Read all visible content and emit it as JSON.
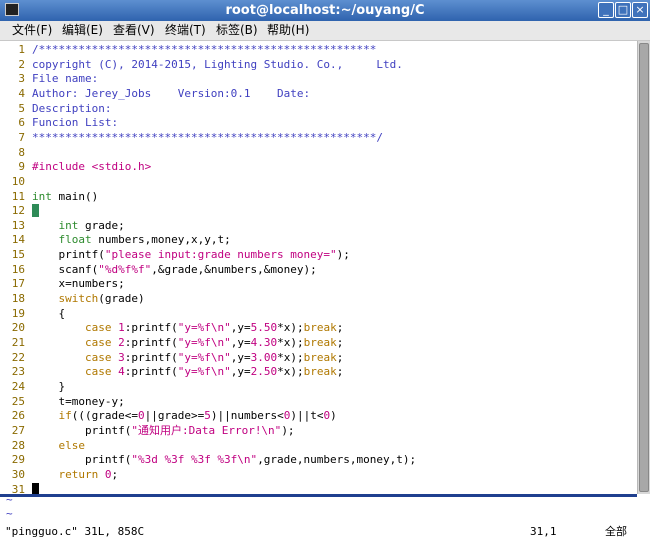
{
  "window": {
    "title": "root@localhost:~/ouyang/C",
    "controls": [
      "_",
      "□",
      "×"
    ]
  },
  "menu": [
    "文件(F)",
    "编辑(E)",
    "查看(V)",
    "终端(T)",
    "标签(B)",
    "帮助(H)"
  ],
  "editor": {
    "lines": [
      {
        "n": "1",
        "segs": [
          {
            "t": "/***************************************************",
            "c": "cm"
          }
        ]
      },
      {
        "n": "2",
        "segs": [
          {
            "t": "copyright (C), 2014-2015, Lighting Studio. Co.,     Ltd.",
            "c": "cm"
          }
        ]
      },
      {
        "n": "3",
        "segs": [
          {
            "t": "File name:",
            "c": "cm"
          }
        ]
      },
      {
        "n": "4",
        "segs": [
          {
            "t": "Author: Jerey_Jobs    Version:0.1    Date:",
            "c": "cm"
          }
        ]
      },
      {
        "n": "5",
        "segs": [
          {
            "t": "Description:",
            "c": "cm"
          }
        ]
      },
      {
        "n": "6",
        "segs": [
          {
            "t": "Funcion List:",
            "c": "cm"
          }
        ]
      },
      {
        "n": "7",
        "segs": [
          {
            "t": "****************************************************/",
            "c": "cm"
          }
        ]
      },
      {
        "n": "8",
        "segs": []
      },
      {
        "n": "9",
        "segs": [
          {
            "t": "#include <stdio.h>",
            "c": "pp"
          }
        ]
      },
      {
        "n": "10",
        "segs": []
      },
      {
        "n": "11",
        "segs": [
          {
            "t": "int",
            "c": "ty"
          },
          {
            "t": " main()",
            "c": ""
          }
        ]
      },
      {
        "n": "12",
        "segs": [
          {
            "t": "{",
            "c": "cur"
          }
        ]
      },
      {
        "n": "13",
        "segs": [
          {
            "t": "    ",
            "c": ""
          },
          {
            "t": "int",
            "c": "ty"
          },
          {
            "t": " grade;",
            "c": ""
          }
        ]
      },
      {
        "n": "14",
        "segs": [
          {
            "t": "    ",
            "c": ""
          },
          {
            "t": "float",
            "c": "ty"
          },
          {
            "t": " numbers,money,x,y,t;",
            "c": ""
          }
        ]
      },
      {
        "n": "15",
        "segs": [
          {
            "t": "    printf(",
            "c": ""
          },
          {
            "t": "\"please input:grade numbers money=\"",
            "c": "st"
          },
          {
            "t": ");",
            "c": ""
          }
        ]
      },
      {
        "n": "16",
        "segs": [
          {
            "t": "    scanf(",
            "c": ""
          },
          {
            "t": "\"%d%f%f\"",
            "c": "st"
          },
          {
            "t": ",&grade,&numbers,&money);",
            "c": ""
          }
        ]
      },
      {
        "n": "17",
        "segs": [
          {
            "t": "    x=numbers;",
            "c": ""
          }
        ]
      },
      {
        "n": "18",
        "segs": [
          {
            "t": "    ",
            "c": ""
          },
          {
            "t": "switch",
            "c": "kw"
          },
          {
            "t": "(grade)",
            "c": ""
          }
        ]
      },
      {
        "n": "19",
        "segs": [
          {
            "t": "    {",
            "c": ""
          }
        ]
      },
      {
        "n": "20",
        "segs": [
          {
            "t": "        ",
            "c": ""
          },
          {
            "t": "case",
            "c": "kw"
          },
          {
            "t": " ",
            "c": ""
          },
          {
            "t": "1",
            "c": "st"
          },
          {
            "t": ":printf(",
            "c": ""
          },
          {
            "t": "\"y=%f\\n\"",
            "c": "st"
          },
          {
            "t": ",y=",
            "c": ""
          },
          {
            "t": "5.50",
            "c": "st"
          },
          {
            "t": "*x);",
            "c": ""
          },
          {
            "t": "break",
            "c": "kw"
          },
          {
            "t": ";",
            "c": ""
          }
        ]
      },
      {
        "n": "21",
        "segs": [
          {
            "t": "        ",
            "c": ""
          },
          {
            "t": "case",
            "c": "kw"
          },
          {
            "t": " ",
            "c": ""
          },
          {
            "t": "2",
            "c": "st"
          },
          {
            "t": ":printf(",
            "c": ""
          },
          {
            "t": "\"y=%f\\n\"",
            "c": "st"
          },
          {
            "t": ",y=",
            "c": ""
          },
          {
            "t": "4.30",
            "c": "st"
          },
          {
            "t": "*x);",
            "c": ""
          },
          {
            "t": "break",
            "c": "kw"
          },
          {
            "t": ";",
            "c": ""
          }
        ]
      },
      {
        "n": "22",
        "segs": [
          {
            "t": "        ",
            "c": ""
          },
          {
            "t": "case",
            "c": "kw"
          },
          {
            "t": " ",
            "c": ""
          },
          {
            "t": "3",
            "c": "st"
          },
          {
            "t": ":printf(",
            "c": ""
          },
          {
            "t": "\"y=%f\\n\"",
            "c": "st"
          },
          {
            "t": ",y=",
            "c": ""
          },
          {
            "t": "3.00",
            "c": "st"
          },
          {
            "t": "*x);",
            "c": ""
          },
          {
            "t": "break",
            "c": "kw"
          },
          {
            "t": ";",
            "c": ""
          }
        ]
      },
      {
        "n": "23",
        "segs": [
          {
            "t": "        ",
            "c": ""
          },
          {
            "t": "case",
            "c": "kw"
          },
          {
            "t": " ",
            "c": ""
          },
          {
            "t": "4",
            "c": "st"
          },
          {
            "t": ":printf(",
            "c": ""
          },
          {
            "t": "\"y=%f\\n\"",
            "c": "st"
          },
          {
            "t": ",y=",
            "c": ""
          },
          {
            "t": "2.50",
            "c": "st"
          },
          {
            "t": "*x);",
            "c": ""
          },
          {
            "t": "break",
            "c": "kw"
          },
          {
            "t": ";",
            "c": ""
          }
        ]
      },
      {
        "n": "24",
        "segs": [
          {
            "t": "    }",
            "c": ""
          }
        ]
      },
      {
        "n": "25",
        "segs": [
          {
            "t": "    t=money-y;",
            "c": ""
          }
        ]
      },
      {
        "n": "26",
        "segs": [
          {
            "t": "    ",
            "c": ""
          },
          {
            "t": "if",
            "c": "kw"
          },
          {
            "t": "(((grade<=",
            "c": ""
          },
          {
            "t": "0",
            "c": "st"
          },
          {
            "t": "||grade>=",
            "c": ""
          },
          {
            "t": "5",
            "c": "st"
          },
          {
            "t": ")||numbers<",
            "c": ""
          },
          {
            "t": "0",
            "c": "st"
          },
          {
            "t": ")||t<",
            "c": ""
          },
          {
            "t": "0",
            "c": "st"
          },
          {
            "t": ")",
            "c": ""
          }
        ]
      },
      {
        "n": "27",
        "segs": [
          {
            "t": "        printf(",
            "c": ""
          },
          {
            "t": "\"通知用户:Data Error!\\n\"",
            "c": "st"
          },
          {
            "t": ");",
            "c": ""
          }
        ]
      },
      {
        "n": "28",
        "segs": [
          {
            "t": "    ",
            "c": ""
          },
          {
            "t": "else",
            "c": "kw"
          }
        ]
      },
      {
        "n": "29",
        "segs": [
          {
            "t": "        printf(",
            "c": ""
          },
          {
            "t": "\"%3d %3f %3f %3f\\n\"",
            "c": "st"
          },
          {
            "t": ",grade,numbers,money,t);",
            "c": ""
          }
        ]
      },
      {
        "n": "30",
        "segs": [
          {
            "t": "    ",
            "c": ""
          },
          {
            "t": "return",
            "c": "kw"
          },
          {
            "t": " ",
            "c": ""
          },
          {
            "t": "0",
            "c": "st"
          },
          {
            "t": ";",
            "c": ""
          }
        ]
      },
      {
        "n": "31",
        "segs": [
          {
            "t": "}",
            "c": "curb"
          }
        ]
      }
    ],
    "tildes": [
      "~",
      "~"
    ]
  },
  "status": {
    "file": "\"pingguo.c\" 31L, 858C",
    "position": "31,1",
    "percent": "全部"
  },
  "colors": {
    "comment": "#4040c0",
    "type": "#2e8b2e",
    "preproc_string": "#c00080",
    "keyword": "#b07800",
    "line_number": "#8a6a00",
    "cursor": "#2e8b57"
  }
}
